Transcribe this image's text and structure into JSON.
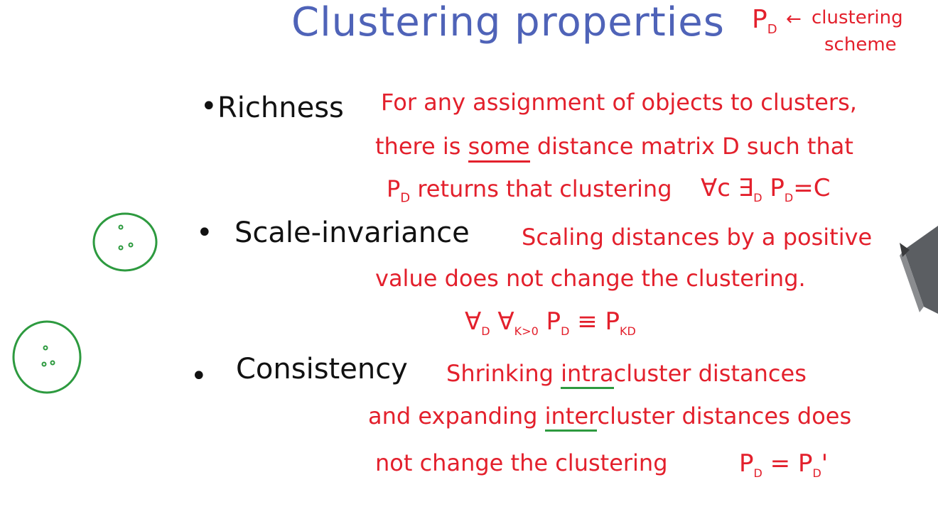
{
  "title": "Clustering properties",
  "header_note": {
    "symbol": "P",
    "subscript": "D",
    "arrow": "←",
    "line1": "clustering",
    "line2": "scheme"
  },
  "properties": [
    {
      "term": "Richness",
      "definition_lines": [
        "For any assignment of objects to clusters,",
        "distance matrix D such that",
        "P",
        "returns that clustering"
      ],
      "underlined_word": "some",
      "line2_prefix": "there is",
      "formula": "∀c ∃D P_D = C"
    },
    {
      "term": "Scale-invariance",
      "definition_lines": [
        "Scaling distances by a positive",
        "value does not change the clustering."
      ],
      "formula": "∀D ∀K>0 P_D ≡ P_KD"
    },
    {
      "term": "Consistency",
      "definition_lines": [
        "Shrinking",
        "cluster distances",
        "and expanding",
        "cluster distances does",
        "not change the clustering"
      ],
      "intra_prefix": "intra",
      "inter_prefix": "inter",
      "formula": "P_D = P_D'"
    }
  ],
  "colors": {
    "title": "#4f63b8",
    "terms": "#111111",
    "definitions": "#e3202c",
    "sketches": "#2d9a3f"
  }
}
